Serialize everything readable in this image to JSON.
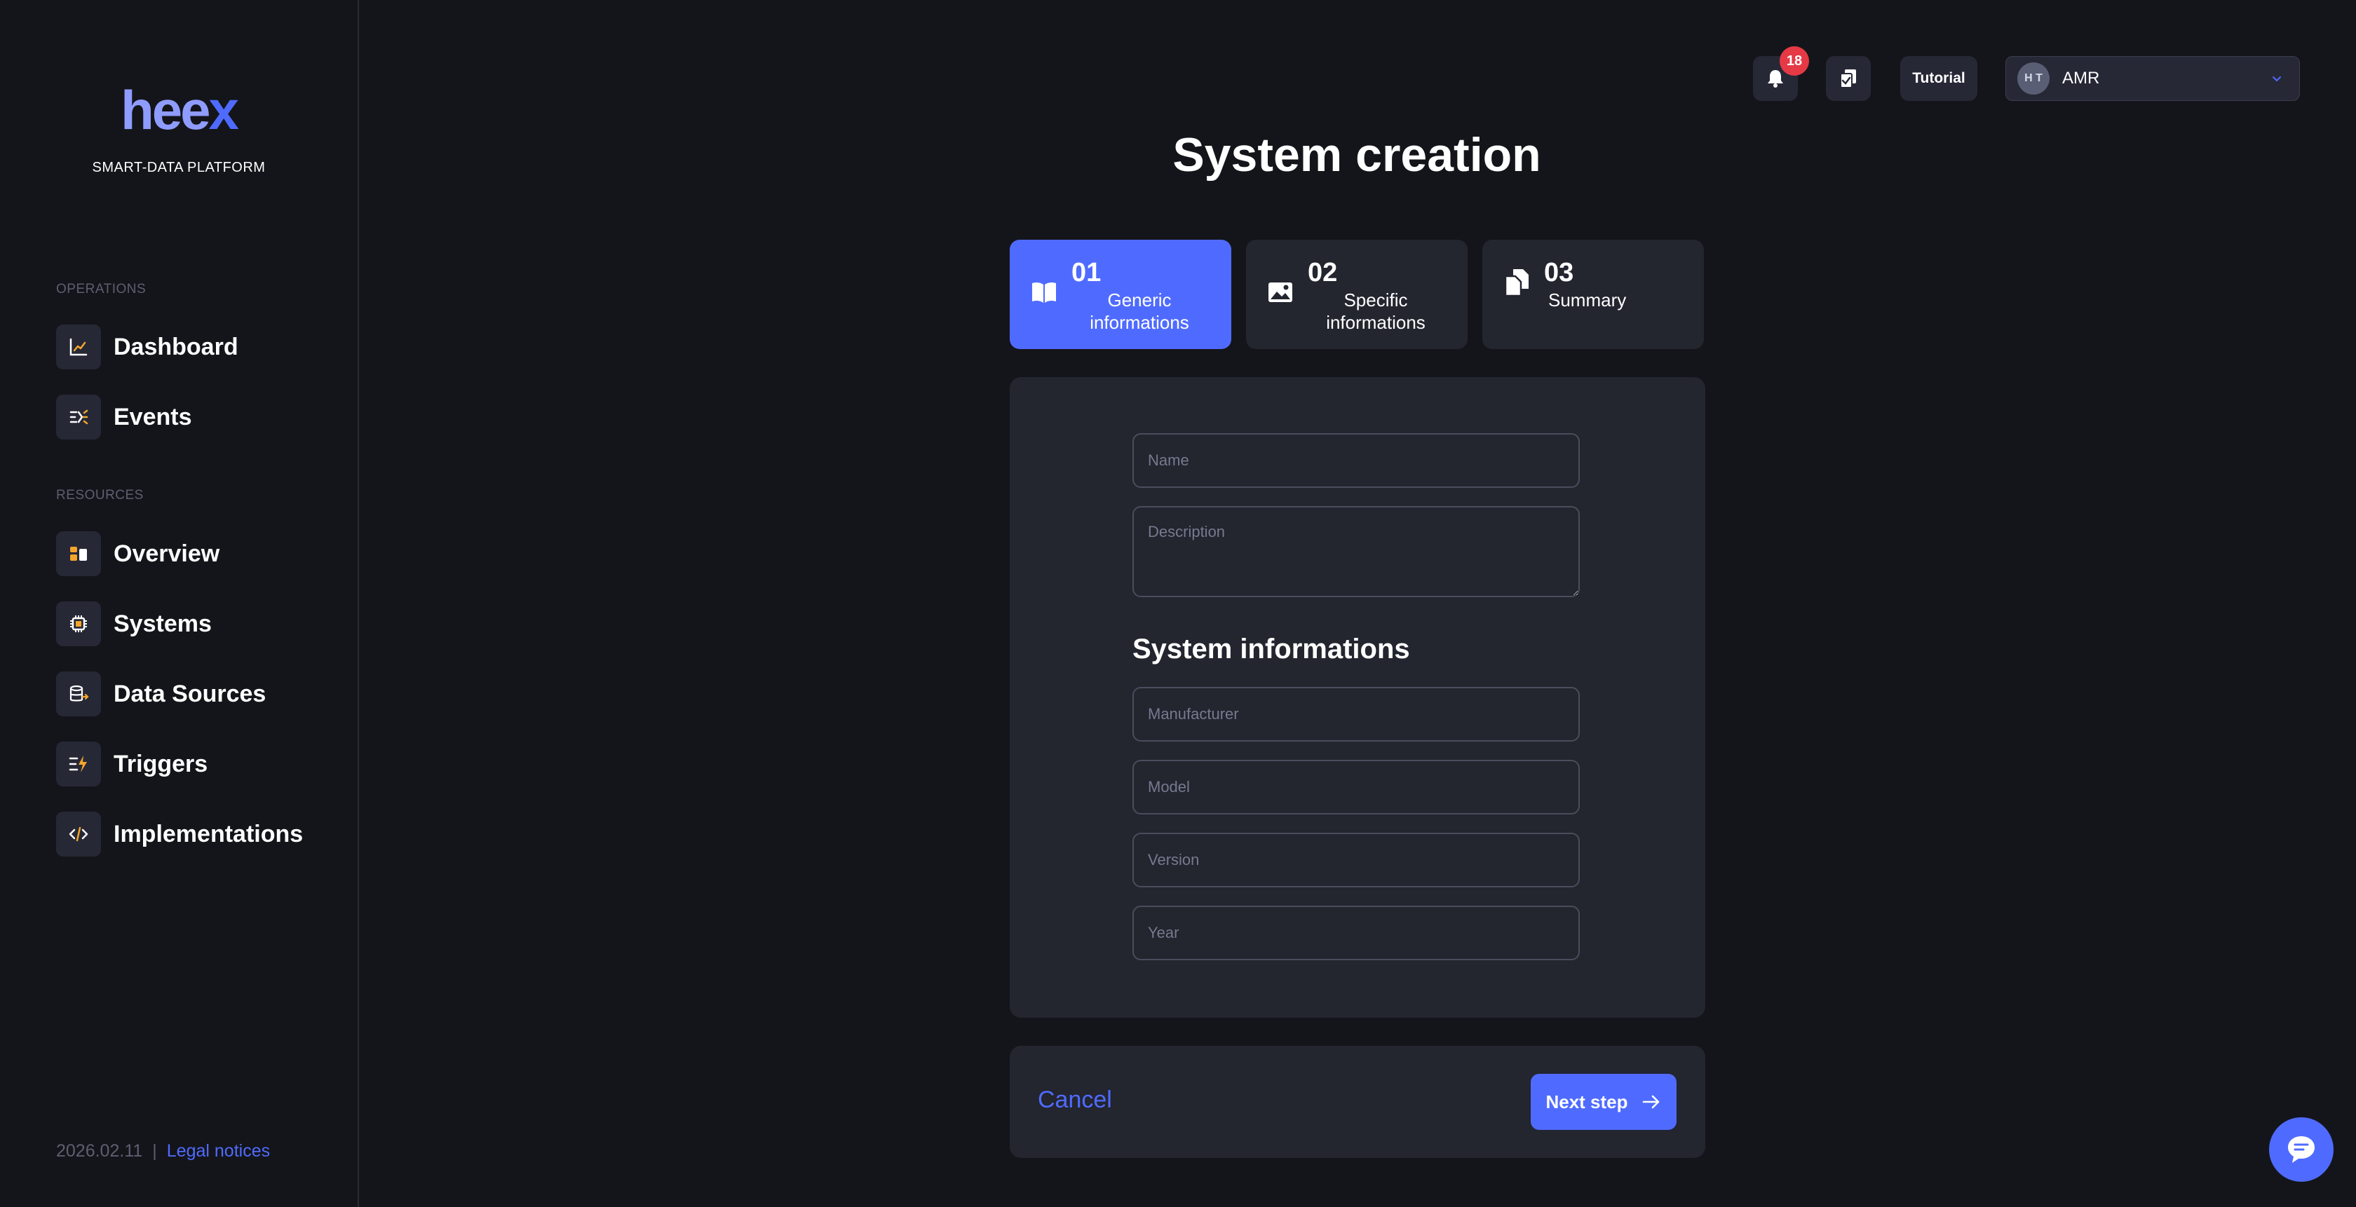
{
  "brand": {
    "logo_main": "hee",
    "logo_accent": "x",
    "tagline": "SMART-DATA PLATFORM"
  },
  "sidebar": {
    "sections": [
      {
        "label": "OPERATIONS",
        "items": [
          {
            "label": "Dashboard",
            "icon": "chart-line-icon"
          },
          {
            "label": "Events",
            "icon": "events-icon"
          }
        ]
      },
      {
        "label": "RESOURCES",
        "items": [
          {
            "label": "Overview",
            "icon": "overview-icon"
          },
          {
            "label": "Systems",
            "icon": "chip-icon"
          },
          {
            "label": "Data Sources",
            "icon": "database-icon"
          },
          {
            "label": "Triggers",
            "icon": "trigger-icon"
          },
          {
            "label": "Implementations",
            "icon": "code-icon"
          }
        ]
      }
    ],
    "footer": {
      "date": "2026.02.11",
      "separator": "|",
      "legal": "Legal notices"
    }
  },
  "header": {
    "notifications_count": "18",
    "tutorial_label": "Tutorial",
    "user": {
      "initials": "H T",
      "name": "AMR"
    }
  },
  "page": {
    "title": "System creation"
  },
  "steps": [
    {
      "num": "01",
      "label_line1": "Generic",
      "label_line2": "informations",
      "active": true,
      "icon": "book-icon"
    },
    {
      "num": "02",
      "label_line1": "Specific",
      "label_line2": "informations",
      "active": false,
      "icon": "image-icon"
    },
    {
      "num": "03",
      "label_line1": "Summary",
      "label_line2": "",
      "active": false,
      "icon": "copy-icon"
    }
  ],
  "form": {
    "name_placeholder": "Name",
    "description_placeholder": "Description",
    "section_title": "System informations",
    "manufacturer_placeholder": "Manufacturer",
    "model_placeholder": "Model",
    "version_placeholder": "Version",
    "year_placeholder": "Year"
  },
  "actions": {
    "cancel": "Cancel",
    "next": "Next step"
  },
  "colors": {
    "accent": "#4f6bff",
    "background": "#14151a",
    "card": "#23252f",
    "badge": "#e53945",
    "icon_orange": "#f4a52b"
  }
}
